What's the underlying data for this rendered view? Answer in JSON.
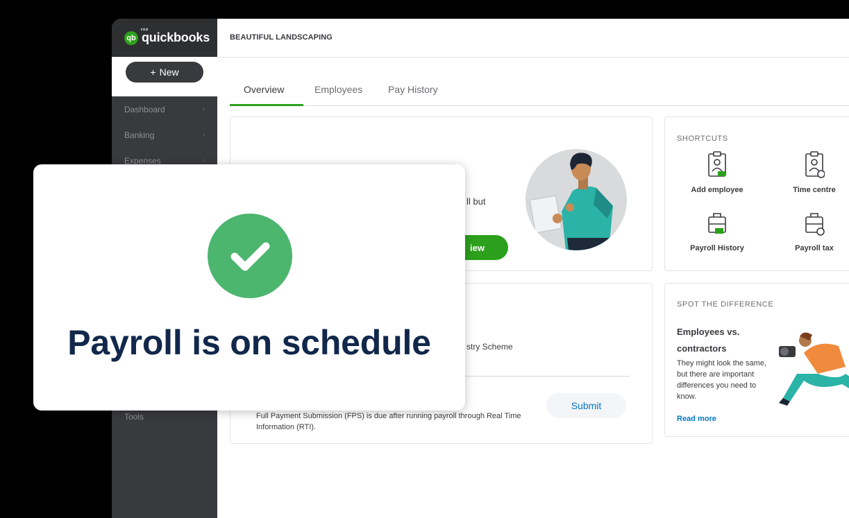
{
  "brand": {
    "logo_text": "quickbooks",
    "logo_intuit": "intuit",
    "logo_mark": "qb"
  },
  "sidebar": {
    "new_label": "New",
    "items": [
      {
        "label": "Dashboard"
      },
      {
        "label": "Banking"
      },
      {
        "label": "Expenses"
      }
    ],
    "tools_label": "Tools"
  },
  "header": {
    "company": "BEAUTIFUL LANDSCAPING"
  },
  "tabs": [
    {
      "label": "Overview",
      "active": true
    },
    {
      "label": "Employees",
      "active": false
    },
    {
      "label": "Pay History",
      "active": false
    }
  ],
  "main_card": {
    "text_fragment": "ll but",
    "button_fragment": "iew"
  },
  "shortcuts": {
    "title": "SHORTCUTS",
    "items": [
      {
        "label": "Add employee",
        "icon": "clipboard-person-icon"
      },
      {
        "label": "Time centre",
        "icon": "clipboard-clock-icon"
      },
      {
        "label": "Payroll History",
        "icon": "briefcase-money-icon"
      },
      {
        "label": "Payroll tax",
        "icon": "briefcase-clock-icon"
      }
    ]
  },
  "tasks_card": {
    "fragment": "stry Scheme",
    "task_description": "Full Payment Submission (FPS) is due after running payroll through Real Time Information (RTI).",
    "submit_label": "Submit"
  },
  "spot": {
    "title": "SPOT THE DIFFERENCE",
    "heading": "Employees vs. contractors",
    "body": "They might look the same, but there are important differences you need to know.",
    "link": "Read more"
  },
  "overlay": {
    "message": "Payroll is on schedule"
  },
  "colors": {
    "brand_green": "#2ca01c",
    "sidebar": "#393a3d",
    "success": "#4cb56e",
    "navy": "#11284b",
    "link": "#0077c5"
  }
}
